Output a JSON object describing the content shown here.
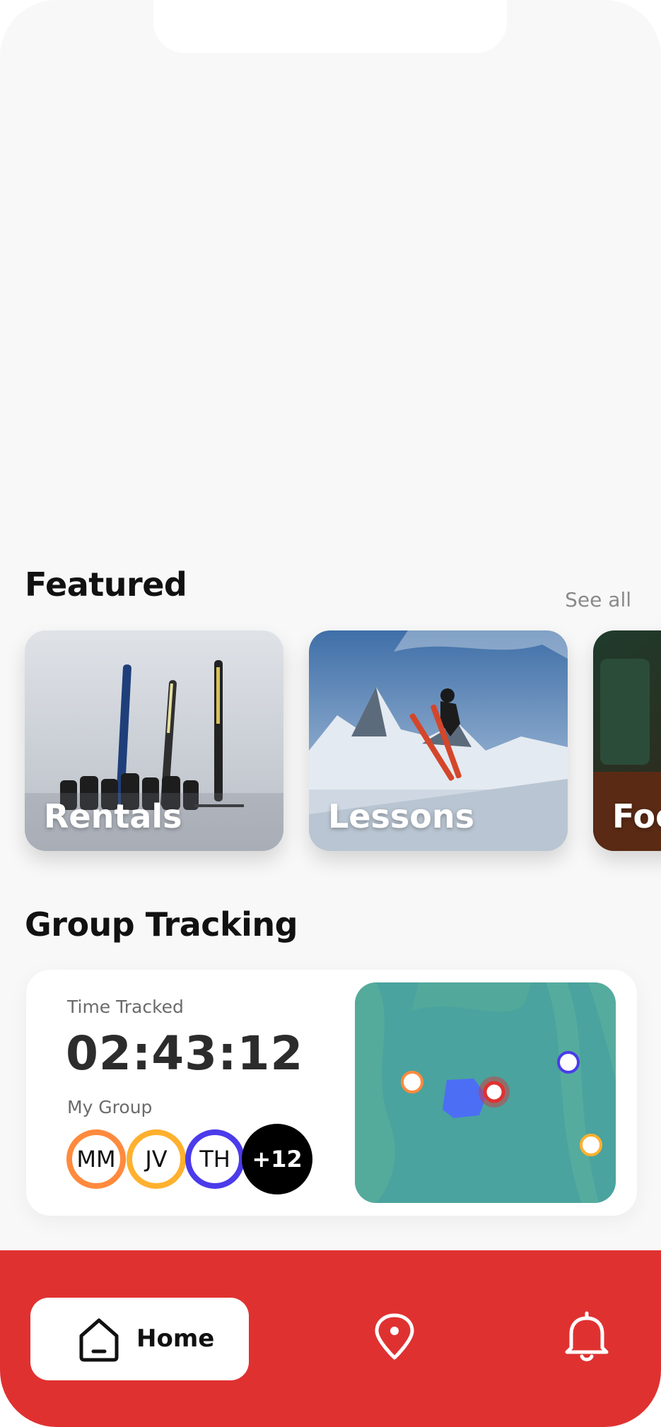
{
  "featured": {
    "title": "Featured",
    "see_all": "See all",
    "cards": [
      {
        "label": "Rentals"
      },
      {
        "label": "Lessons"
      },
      {
        "label": "Food"
      }
    ]
  },
  "group_tracking": {
    "title": "Group Tracking",
    "time_tracked_label": "Time Tracked",
    "time_tracked_value": "02:43:12",
    "my_group_label": "My Group",
    "members": [
      {
        "initials": "MM",
        "color": "#ff8a3d"
      },
      {
        "initials": "JV",
        "color": "#ffb02e"
      },
      {
        "initials": "TH",
        "color": "#4b3bea"
      }
    ],
    "more_count": "+12"
  },
  "nav": {
    "home_label": "Home",
    "items": [
      "home-icon",
      "location-pin-icon",
      "bell-icon"
    ]
  },
  "colors": {
    "accent": "#e03131",
    "map": "#4aa39e"
  }
}
